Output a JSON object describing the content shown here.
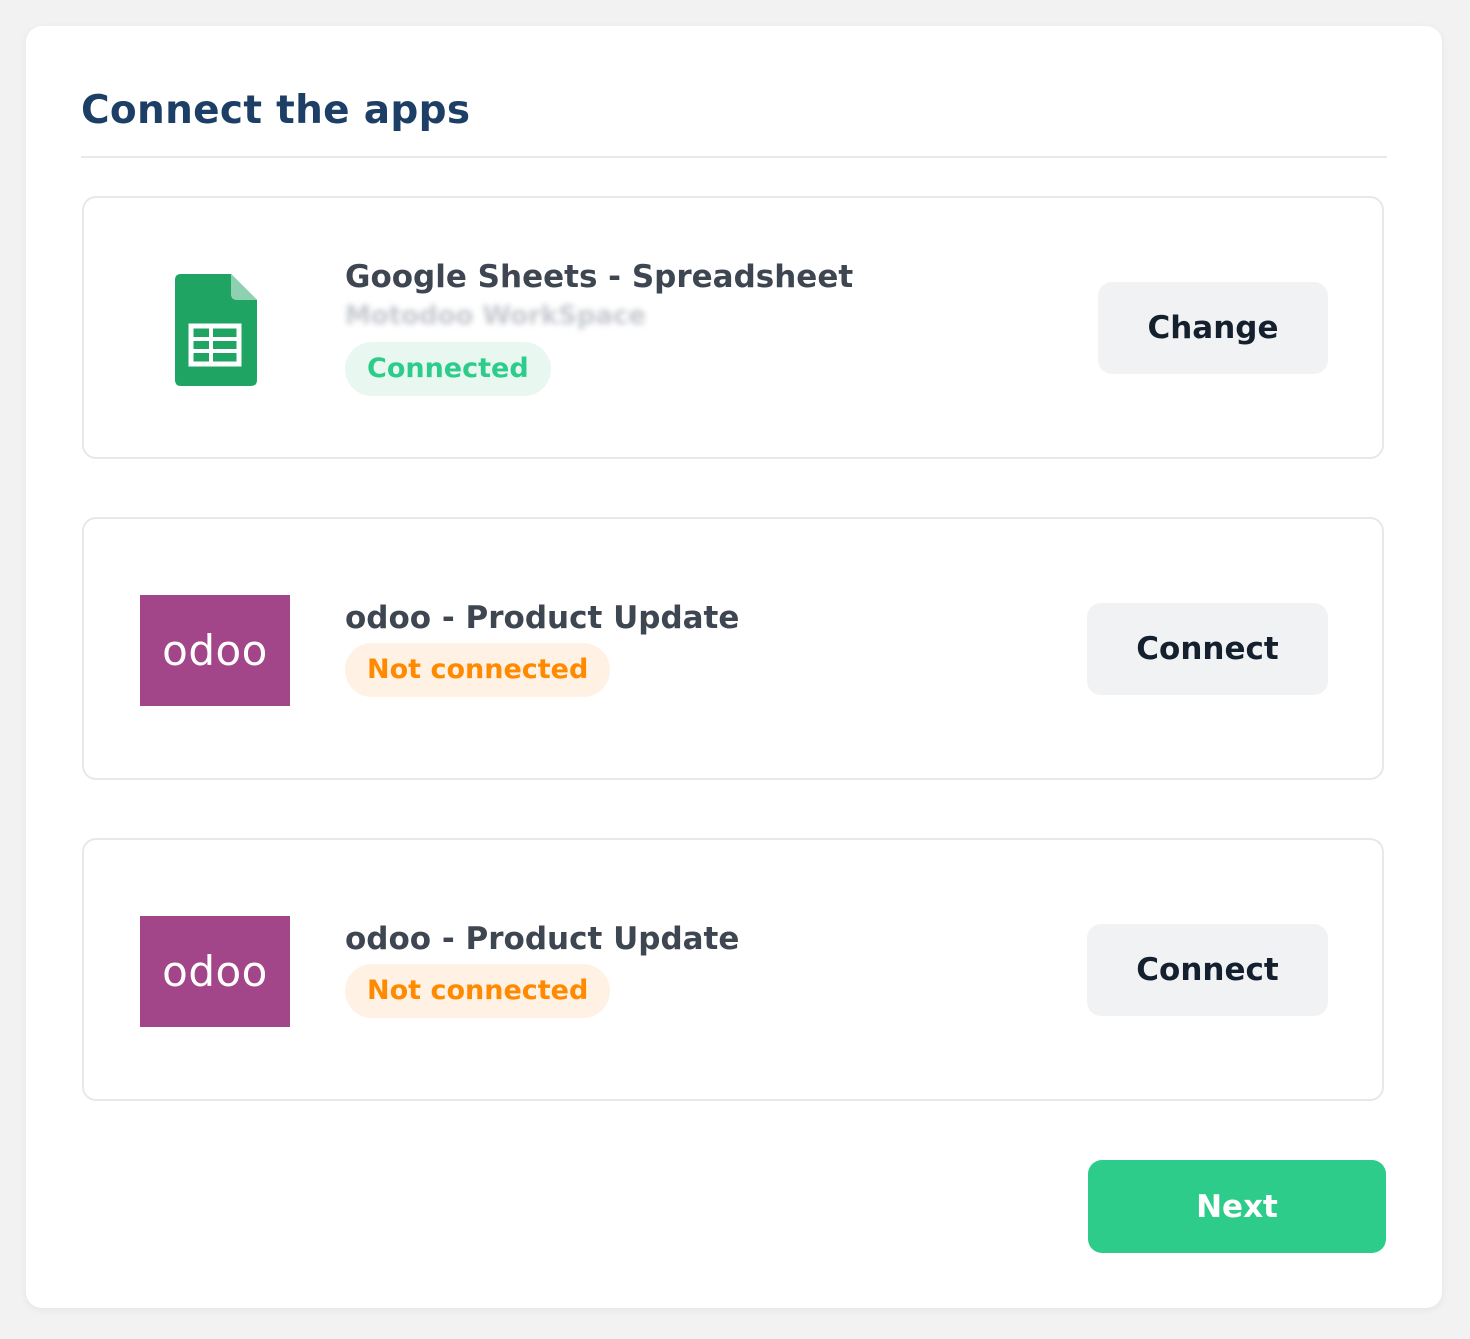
{
  "page": {
    "title": "Connect the apps"
  },
  "apps": [
    {
      "name": "Google Sheets - Spreadsheet",
      "account": "Motodoo WorkSpace",
      "status": "Connected",
      "action_label": "Change",
      "icon": "google-sheets-icon"
    },
    {
      "name": "odoo - Product Update",
      "status": "Not connected",
      "action_label": "Connect",
      "logo_text": "odoo",
      "icon": "odoo-logo"
    },
    {
      "name": "odoo - Product Update",
      "status": "Not connected",
      "action_label": "Connect",
      "logo_text": "odoo",
      "icon": "odoo-logo"
    }
  ],
  "footer": {
    "next_label": "Next"
  },
  "colors": {
    "heading": "#1d3f66",
    "primary_green": "#2ecc8b",
    "connected_bg": "#e8f8f0",
    "not_connected_text": "#ff8a00",
    "not_connected_bg": "#fff1e4",
    "odoo_purple": "#a24689",
    "sheets_green": "#1fa463"
  }
}
